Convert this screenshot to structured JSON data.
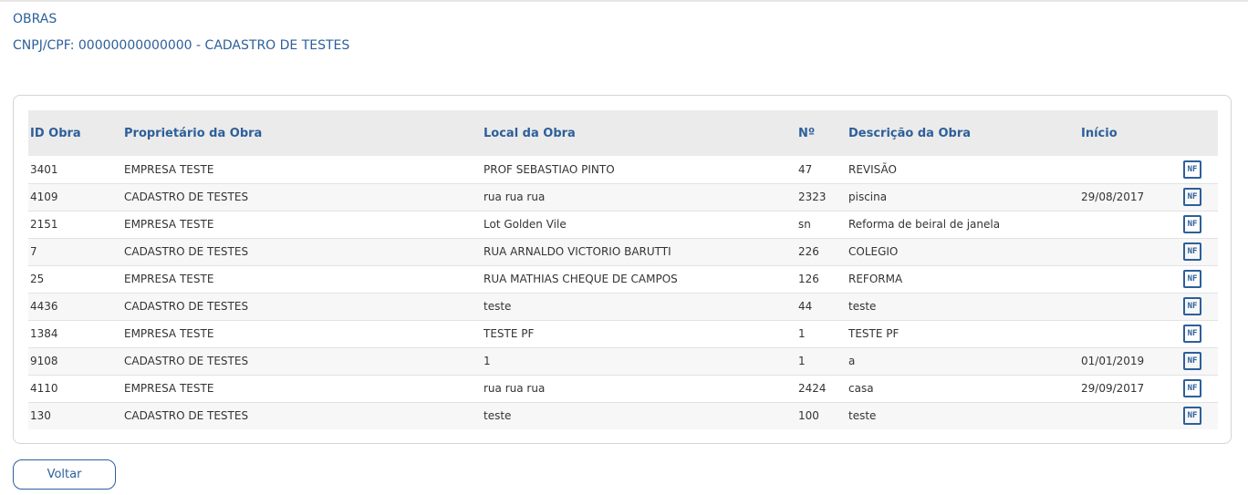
{
  "header": {
    "title": "OBRAS",
    "subtitle": "CNPJ/CPF: 00000000000000 - CADASTRO DE TESTES"
  },
  "table": {
    "columns": [
      "ID Obra",
      "Proprietário da Obra",
      "Local da Obra",
      "Nº",
      "Descrição da Obra",
      "Início",
      ""
    ],
    "rows": [
      {
        "id": "3401",
        "owner": "EMPRESA TESTE",
        "location": "PROF SEBASTIAO PINTO",
        "number": "47",
        "description": "REVISÃO",
        "start": "",
        "action": "NF"
      },
      {
        "id": "4109",
        "owner": "CADASTRO DE TESTES",
        "location": "rua rua rua",
        "number": "2323",
        "description": "piscina",
        "start": "29/08/2017",
        "action": "NF"
      },
      {
        "id": "2151",
        "owner": "EMPRESA TESTE",
        "location": "Lot Golden Vile",
        "number": "sn",
        "description": "Reforma de beiral de janela",
        "start": "",
        "action": "NF"
      },
      {
        "id": "7",
        "owner": "CADASTRO DE TESTES",
        "location": "RUA ARNALDO VICTORIO BARUTTI",
        "number": "226",
        "description": "COLEGIO",
        "start": "",
        "action": "NF"
      },
      {
        "id": "25",
        "owner": "EMPRESA TESTE",
        "location": "RUA MATHIAS CHEQUE DE CAMPOS",
        "number": "126",
        "description": "REFORMA",
        "start": "",
        "action": "NF"
      },
      {
        "id": "4436",
        "owner": "CADASTRO DE TESTES",
        "location": "teste",
        "number": "44",
        "description": "teste",
        "start": "",
        "action": "NF"
      },
      {
        "id": "1384",
        "owner": "EMPRESA TESTE",
        "location": "TESTE PF",
        "number": "1",
        "description": "TESTE PF",
        "start": "",
        "action": "NF"
      },
      {
        "id": "9108",
        "owner": "CADASTRO DE TESTES",
        "location": "1",
        "number": "1",
        "description": "a",
        "start": "01/01/2019",
        "action": "NF"
      },
      {
        "id": "4110",
        "owner": "EMPRESA TESTE",
        "location": "rua rua rua",
        "number": "2424",
        "description": "casa",
        "start": "29/09/2017",
        "action": "NF"
      },
      {
        "id": "130",
        "owner": "CADASTRO DE TESTES",
        "location": "teste",
        "number": "100",
        "description": "teste",
        "start": "",
        "action": "NF"
      }
    ]
  },
  "actions": {
    "back_label": "Voltar"
  },
  "colors": {
    "accent": "#2d5f9a",
    "header_bg": "#ebebeb",
    "border": "#d4d4d4"
  }
}
